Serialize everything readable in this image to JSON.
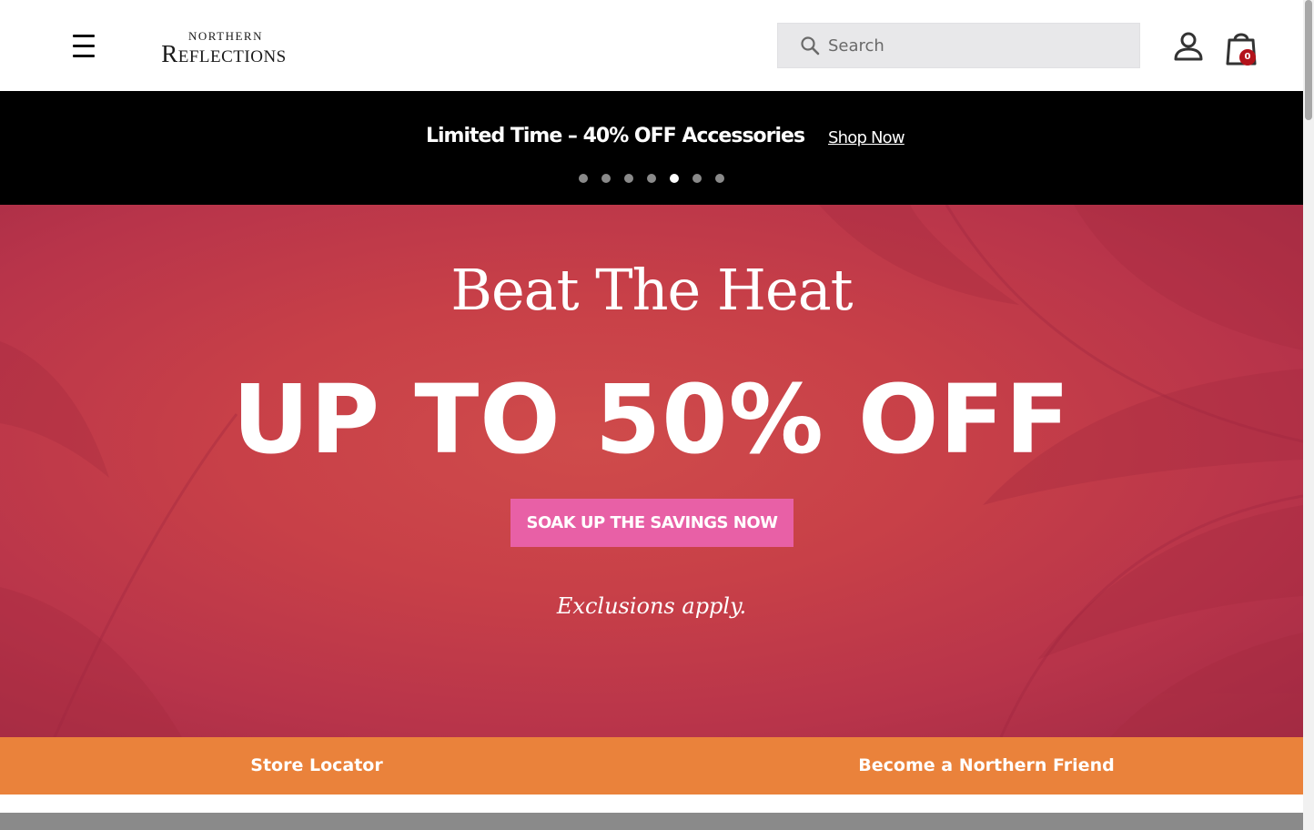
{
  "header": {
    "logo_top": "NORTHERN",
    "logo_main": "Reflections",
    "search_placeholder": "Search",
    "cart_count": "0"
  },
  "promo": {
    "text": "Limited Time – 40% OFF Accessories",
    "link": "Shop Now",
    "slide_count": 7,
    "active_slide": 5
  },
  "hero": {
    "title": "Beat The Heat",
    "headline": "UP TO 50% OFF",
    "cta": "SOAK UP THE SAVINGS NOW",
    "note": "Exclusions apply."
  },
  "footer_bar": {
    "store_locator": "Store Locator",
    "friend": "Become a Northern Friend"
  },
  "colors": {
    "promo_bg": "#000000",
    "hero_red": "#c84048",
    "cta_pink": "#e860a6",
    "orange": "#ea823b",
    "cart_badge": "#b3131b"
  }
}
